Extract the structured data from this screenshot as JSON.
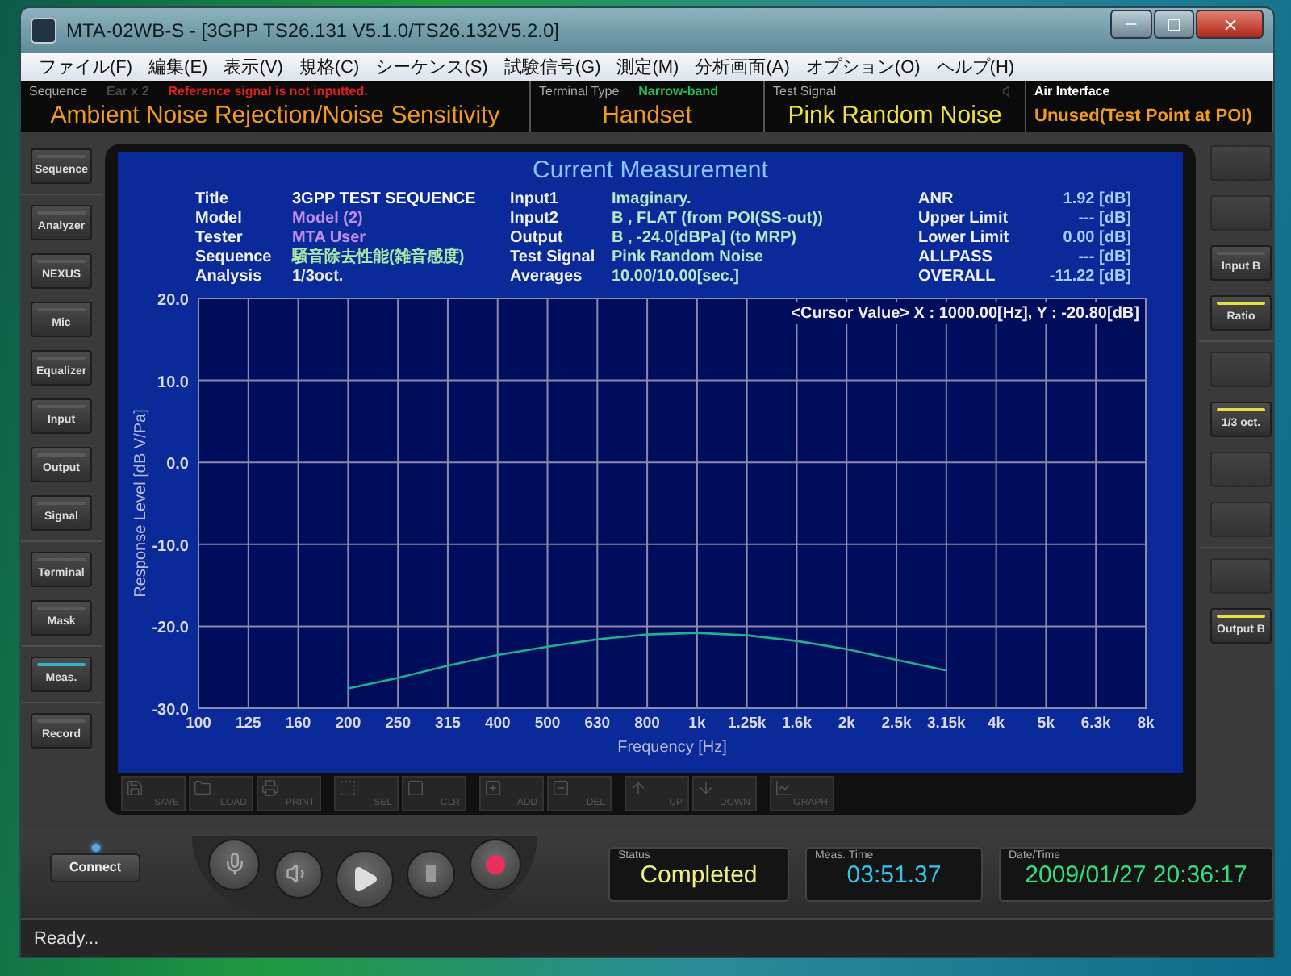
{
  "window": {
    "title": "MTA-02WB-S - [3GPP TS26.131 V5.1.0/TS26.132V5.2.0]"
  },
  "menu": [
    "ファイル(F)",
    "編集(E)",
    "表示(V)",
    "規格(C)",
    "シーケンス(S)",
    "試験信号(G)",
    "測定(M)",
    "分析画面(A)",
    "オプション(O)",
    "ヘルプ(H)"
  ],
  "info_bar": [
    {
      "label": "Sequence",
      "notes": [
        {
          "text": "Ear x 2",
          "color": "#4a4a4a"
        },
        {
          "text": "Reference signal is not inputted.",
          "color": "#e02020"
        }
      ],
      "value": "Ambient Noise Rejection/Noise Sensitivity",
      "color": "#f09a20"
    },
    {
      "label": "Terminal Type",
      "notes": [
        {
          "text": "Narrow-band",
          "color": "#20c060"
        }
      ],
      "value": "Handset",
      "color": "#f09a20"
    },
    {
      "label": "Test Signal",
      "value": "Pink Random Noise",
      "color": "#f0e040"
    },
    {
      "label": "Air Interface",
      "value": "Unused(Test Point at POI)",
      "color": "#f09a20"
    }
  ],
  "left_sidebar": [
    [
      {
        "label": "Sequence",
        "selected": false
      }
    ],
    [
      {
        "label": "Analyzer",
        "selected": false
      },
      {
        "label": "NEXUS",
        "selected": false
      },
      {
        "label": "Mic",
        "selected": false
      },
      {
        "label": "Equalizer",
        "selected": false
      },
      {
        "label": "Input",
        "selected": false
      },
      {
        "label": "Output",
        "selected": false
      },
      {
        "label": "Signal",
        "selected": false
      }
    ],
    [
      {
        "label": "Terminal",
        "selected": false
      },
      {
        "label": "Mask",
        "selected": false
      }
    ],
    [
      {
        "label": "Meas.",
        "selected": true
      }
    ],
    [
      {
        "label": "Record",
        "selected": false
      }
    ]
  ],
  "right_sidebar": [
    [
      {
        "kind": "blank"
      },
      {
        "kind": "blank"
      },
      {
        "kind": "button",
        "label": "Input B",
        "on": false
      },
      {
        "kind": "button",
        "label": "Ratio",
        "on": true
      }
    ],
    [
      {
        "kind": "blank"
      },
      {
        "kind": "button",
        "label": "1/3 oct.",
        "on": true
      },
      {
        "kind": "blank"
      },
      {
        "kind": "blank"
      }
    ],
    [
      {
        "kind": "blank"
      },
      {
        "kind": "button",
        "label": "Output B",
        "on": true
      }
    ]
  ],
  "measurement": {
    "title": "Current Measurement",
    "info_columns": [
      [
        {
          "label": "Title",
          "value": "3GPP TEST SEQUENCE",
          "color": "#ffffff"
        },
        {
          "label": "Model",
          "value": "Model (2)",
          "color": "#c08ce8"
        },
        {
          "label": "Tester",
          "value": "MTA User",
          "color": "#c08ce8"
        },
        {
          "label": "Sequence",
          "value": "騒音除去性能(雑音感度)",
          "color": "#a8e8a8"
        },
        {
          "label": "Analysis",
          "value": "1/3oct.",
          "color": "#e8e8e8"
        }
      ],
      [
        {
          "label": "Input1",
          "value": "Imaginary."
        },
        {
          "label": "Input2",
          "value": "B , FLAT (from POI(SS-out))"
        },
        {
          "label": "Output",
          "value": "B , -24.0[dBPa] (to MRP)"
        },
        {
          "label": "Test Signal",
          "value": "Pink Random Noise"
        },
        {
          "label": "Averages",
          "value": "10.00/10.00[sec.]"
        }
      ],
      [
        {
          "label": "ANR",
          "value": "1.92 [dB]"
        },
        {
          "label": "Upper Limit",
          "value": "--- [dB]"
        },
        {
          "label": "Lower Limit",
          "value": "0.00 [dB]"
        },
        {
          "label": "ALLPASS",
          "value": "--- [dB]"
        },
        {
          "label": "OVERALL",
          "value": "-11.22 [dB]"
        }
      ]
    ],
    "cursor_value": "<Cursor Value> X : 1000.00[Hz], Y : -20.80[dB]",
    "chart_data": {
      "type": "line",
      "grid": true,
      "xlabel": "Frequency [Hz]",
      "ylabel": "Response Level [dB V/Pa]",
      "categories": [
        "100",
        "125",
        "160",
        "200",
        "250",
        "315",
        "400",
        "500",
        "630",
        "800",
        "1k",
        "1.25k",
        "1.6k",
        "2k",
        "2.5k",
        "3.15k",
        "4k",
        "5k",
        "6.3k",
        "8k"
      ],
      "series": [
        {
          "color": "#20b090",
          "values": [
            null,
            null,
            null,
            -27.6,
            -26.3,
            -24.8,
            -23.5,
            -22.5,
            -21.6,
            -21.0,
            -20.8,
            -21.1,
            -21.8,
            -22.8,
            -24.1,
            -25.4,
            null,
            null,
            null,
            null
          ]
        }
      ],
      "ylim": [
        -30,
        20
      ],
      "yticks": [
        {
          "value": -30,
          "label": "-30.0"
        },
        {
          "value": -20,
          "label": "-20.0"
        },
        {
          "value": -10,
          "label": "-10.0"
        },
        {
          "value": 0,
          "label": "0.0"
        },
        {
          "value": 10,
          "label": "10.0"
        },
        {
          "value": 20,
          "label": "20.0"
        }
      ]
    }
  },
  "toolbar": [
    [
      {
        "kind": "save",
        "label": "SAVE",
        "disabled": true
      },
      {
        "kind": "load",
        "label": "LOAD",
        "disabled": true
      },
      {
        "kind": "print",
        "label": "PRINT",
        "disabled": true
      }
    ],
    [
      {
        "kind": "select",
        "label": "SEL",
        "disabled": true
      },
      {
        "kind": "clear",
        "label": "CLR",
        "disabled": true
      }
    ],
    [
      {
        "kind": "add",
        "label": "ADD",
        "disabled": true
      },
      {
        "kind": "delete",
        "label": "DEL",
        "disabled": true
      }
    ],
    [
      {
        "kind": "up",
        "label": "UP",
        "disabled": true
      },
      {
        "kind": "down",
        "label": "DOWN",
        "disabled": true
      }
    ],
    [
      {
        "kind": "graph",
        "label": "GRAPH",
        "disabled": true
      }
    ]
  ],
  "connect_button": {
    "label": "Connect"
  },
  "readouts": [
    {
      "label": "Status",
      "value": "Completed",
      "color": "#f0f080"
    },
    {
      "label": "Meas. Time",
      "value": "03:51.37",
      "color": "#30c8f0"
    },
    {
      "label": "Date/Time",
      "value": "2009/01/27 20:36:17",
      "color": "#30e080"
    }
  ],
  "status_bar": "Ready..."
}
